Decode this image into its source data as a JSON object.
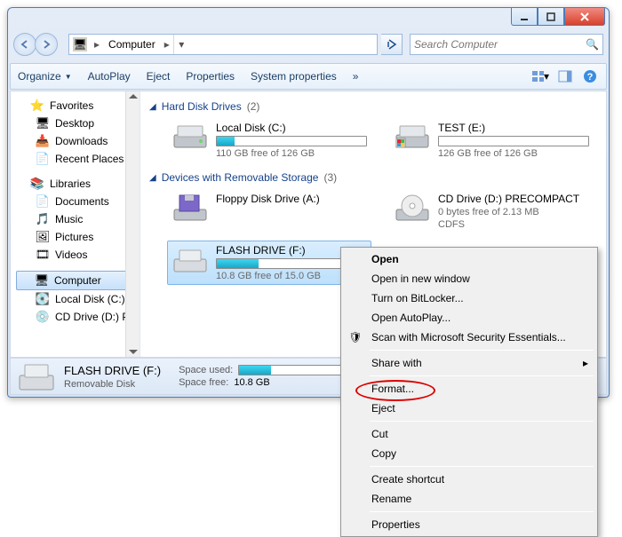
{
  "window": {
    "title": "Computer",
    "min_tooltip": "Minimize",
    "max_tooltip": "Maximize",
    "close_tooltip": "Close"
  },
  "nav": {
    "back_label": "Back",
    "fwd_label": "Forward",
    "breadcrumb": [
      "Computer"
    ],
    "refresh_label": "Refresh"
  },
  "search": {
    "placeholder": "Search Computer"
  },
  "toolbar": {
    "organize": "Organize",
    "autoplay": "AutoPlay",
    "eject": "Eject",
    "properties": "Properties",
    "system_properties": "System properties",
    "overflow": "»",
    "view_tooltip": "Change your view",
    "preview_tooltip": "Show the preview pane",
    "help_tooltip": "Get help"
  },
  "sidebar": {
    "favorites": {
      "label": "Favorites",
      "items": [
        {
          "icon": "desktop",
          "label": "Desktop"
        },
        {
          "icon": "downloads",
          "label": "Downloads"
        },
        {
          "icon": "recent",
          "label": "Recent Places"
        }
      ]
    },
    "libraries": {
      "label": "Libraries",
      "items": [
        {
          "icon": "documents",
          "label": "Documents"
        },
        {
          "icon": "music",
          "label": "Music"
        },
        {
          "icon": "pictures",
          "label": "Pictures"
        },
        {
          "icon": "videos",
          "label": "Videos"
        }
      ]
    },
    "computer": {
      "label": "Computer",
      "items": [
        {
          "icon": "hdd",
          "label": "Local Disk (C:)"
        },
        {
          "icon": "cd",
          "label": "CD Drive (D:) PRECOMPACT"
        }
      ]
    }
  },
  "main": {
    "groups": [
      {
        "id": "hdd",
        "title": "Hard Disk Drives",
        "count": "(2)",
        "drives": [
          {
            "id": "c",
            "icon": "hdd",
            "title": "Local Disk (C:)",
            "sub": "110 GB free of 126 GB",
            "fill_pct": 12
          },
          {
            "id": "e",
            "icon": "hdd",
            "title": "TEST (E:)",
            "sub": "126 GB free of 126 GB",
            "fill_pct": 0
          }
        ]
      },
      {
        "id": "removable",
        "title": "Devices with Removable Storage",
        "count": "(3)",
        "drives": [
          {
            "id": "a",
            "icon": "floppy",
            "title": "Floppy Disk Drive (A:)",
            "sub": "",
            "fill_pct": null
          },
          {
            "id": "d",
            "icon": "cd",
            "title": "CD Drive (D:) PRECOMPACT",
            "sub": "0 bytes free of 2.13 MB",
            "sub2": "CDFS",
            "fill_pct": null
          },
          {
            "id": "f",
            "icon": "flash",
            "title": "FLASH DRIVE (F:)",
            "sub": "10.8 GB free of 15.0 GB",
            "fill_pct": 28,
            "selected": true
          }
        ]
      }
    ]
  },
  "details": {
    "title": "FLASH DRIVE (F:)",
    "type": "Removable Disk",
    "space_used_label": "Space used:",
    "space_free_label": "Space free:",
    "space_free_value": "10.8 GB",
    "fill_pct": 28
  },
  "context_menu": {
    "items": [
      {
        "label": "Open",
        "bold": true
      },
      {
        "label": "Open in new window"
      },
      {
        "label": "Turn on BitLocker..."
      },
      {
        "label": "Open AutoPlay..."
      },
      {
        "label": "Scan with Microsoft Security Essentials...",
        "icon": "shield"
      },
      {
        "sep": true
      },
      {
        "label": "Share with",
        "submenu": true
      },
      {
        "sep": true
      },
      {
        "label": "Format...",
        "highlight": true
      },
      {
        "label": "Eject"
      },
      {
        "sep": true
      },
      {
        "label": "Cut"
      },
      {
        "label": "Copy"
      },
      {
        "sep": true
      },
      {
        "label": "Create shortcut"
      },
      {
        "label": "Rename"
      },
      {
        "sep": true
      },
      {
        "label": "Properties"
      }
    ]
  }
}
